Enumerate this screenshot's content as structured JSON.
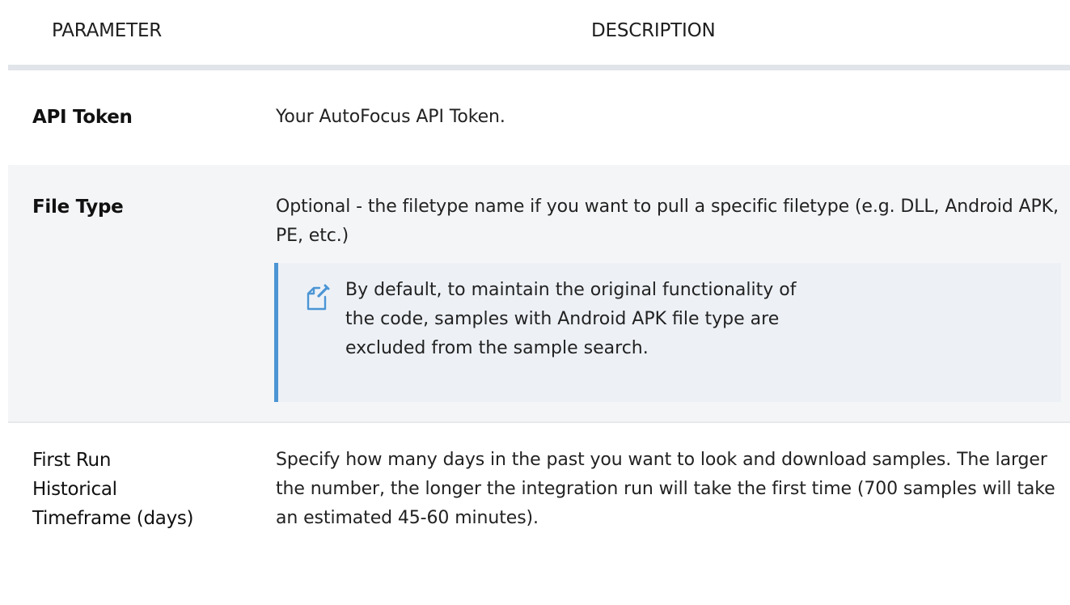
{
  "table": {
    "headers": {
      "parameter": "PARAMETER",
      "description": "DESCRIPTION"
    },
    "rows": [
      {
        "parameter": "API Token",
        "description": "Your AutoFocus API Token."
      },
      {
        "parameter": "File Type",
        "description": "Optional - the filetype name if you want to pull a specific filetype (e.g. DLL, Android APK, PE, etc.)",
        "note": {
          "icon": "note-edit-icon",
          "text": "By default, to maintain the original functionality of the code, samples with  Android APK file type are excluded from the sample search."
        }
      },
      {
        "parameter": "First Run Historical Timeframe (days)",
        "description": "Specify how many days in the past you want to look and download samples.  The larger the number, the longer the integration run will take the first time (700 samples will take an estimated 45-60 minutes)."
      }
    ]
  },
  "colors": {
    "note_accent": "#4c95d4",
    "note_background": "#edf1f6",
    "row_alt_background": "#f4f5f7",
    "divider": "#e1e4e9"
  }
}
